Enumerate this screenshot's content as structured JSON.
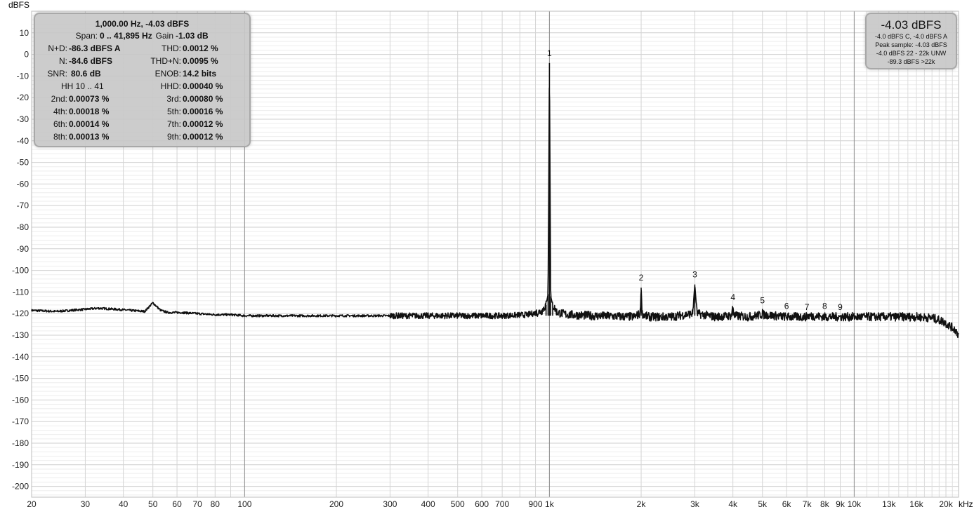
{
  "chart_data": {
    "type": "line",
    "ylabel": "dBFS",
    "xunit": "kHz",
    "xscale": "log",
    "xlim": [
      20,
      22000
    ],
    "ylim": [
      -205,
      20
    ],
    "y_ticks": [
      10,
      0,
      -10,
      -20,
      -30,
      -40,
      -50,
      -60,
      -70,
      -80,
      -90,
      -100,
      -110,
      -120,
      -130,
      -140,
      -150,
      -160,
      -170,
      -180,
      -190,
      -200
    ],
    "x_ticks": [
      {
        "v": 20,
        "label": "20"
      },
      {
        "v": 30,
        "label": "30"
      },
      {
        "v": 40,
        "label": "40"
      },
      {
        "v": 50,
        "label": "50"
      },
      {
        "v": 60,
        "label": "60"
      },
      {
        "v": 70,
        "label": "70"
      },
      {
        "v": 80,
        "label": "80"
      },
      {
        "v": 100,
        "label": "100"
      },
      {
        "v": 200,
        "label": "200"
      },
      {
        "v": 300,
        "label": "300"
      },
      {
        "v": 400,
        "label": "400"
      },
      {
        "v": 500,
        "label": "500"
      },
      {
        "v": 600,
        "label": "600"
      },
      {
        "v": 700,
        "label": "700"
      },
      {
        "v": 900,
        "label": "900"
      },
      {
        "v": 1000,
        "label": "1k"
      },
      {
        "v": 2000,
        "label": "2k"
      },
      {
        "v": 3000,
        "label": "3k"
      },
      {
        "v": 4000,
        "label": "4k"
      },
      {
        "v": 5000,
        "label": "5k"
      },
      {
        "v": 6000,
        "label": "6k"
      },
      {
        "v": 7000,
        "label": "7k"
      },
      {
        "v": 8000,
        "label": "8k"
      },
      {
        "v": 9000,
        "label": "9k"
      },
      {
        "v": 10000,
        "label": "10k"
      },
      {
        "v": 13000,
        "label": "13k"
      },
      {
        "v": 16000,
        "label": "16k"
      },
      {
        "v": 20000,
        "label": "20k"
      }
    ],
    "series": [
      {
        "x": [
          20,
          24,
          27,
          30,
          33,
          38,
          42,
          47,
          50,
          53,
          56,
          62,
          70,
          80,
          90,
          100,
          130,
          180,
          250,
          350,
          500,
          700,
          850,
          940,
          975,
          990,
          1000,
          1010,
          1025,
          1060,
          1150,
          1400,
          1900,
          1985,
          2000,
          2015,
          2100,
          2500,
          2950,
          3000,
          3050,
          3500,
          3950,
          4000,
          4050,
          4500,
          4980,
          5000,
          5020,
          6000,
          6980,
          7000,
          8000,
          9000,
          10000,
          13000,
          16000,
          18000,
          19500,
          20500,
          21500,
          22000
        ],
        "y": [
          -118.5,
          -119,
          -118.5,
          -118,
          -117.5,
          -118,
          -118.5,
          -119,
          -115,
          -118.5,
          -119.5,
          -119.5,
          -120,
          -120.5,
          -120.5,
          -121,
          -121,
          -121,
          -121,
          -121,
          -121,
          -121,
          -120.5,
          -119,
          -116,
          -111,
          -4,
          -112,
          -116,
          -119.5,
          -120.5,
          -121,
          -121.5,
          -120,
          -108,
          -120,
          -121.5,
          -121.5,
          -120,
          -106.5,
          -120,
          -121.5,
          -121,
          -117,
          -121,
          -121.5,
          -120.5,
          -118.5,
          -120.5,
          -121.5,
          -121.5,
          -121,
          -121.5,
          -121.5,
          -121.5,
          -121.5,
          -121.5,
          -122,
          -123.5,
          -125.5,
          -127.5,
          -130
        ]
      }
    ],
    "harmonic_markers": [
      {
        "label": "1",
        "x": 1000,
        "y": -4
      },
      {
        "label": "2",
        "x": 2000,
        "y": -108
      },
      {
        "label": "3",
        "x": 3000,
        "y": -106.5
      },
      {
        "label": "4",
        "x": 4000,
        "y": -117
      },
      {
        "label": "5",
        "x": 5000,
        "y": -118.5
      },
      {
        "label": "6",
        "x": 6000,
        "y": -121
      },
      {
        "label": "7",
        "x": 7000,
        "y": -121.5
      },
      {
        "label": "8",
        "x": 8000,
        "y": -121
      },
      {
        "label": "9",
        "x": 9000,
        "y": -121.5
      }
    ]
  },
  "stats": {
    "title": "1,000.00 Hz, -4.03 dBFS",
    "span_label": "Span:",
    "span_value": "0 .. 41,895 Hz",
    "gain_label": "Gain",
    "gain_value": "-1.03 dB",
    "nd_label": "N+D:",
    "nd_value": "-86.3 dBFS A",
    "thd_label": "THD:",
    "thd_value": "0.0012 %",
    "n_label": "N:",
    "n_value": "-84.6 dBFS",
    "thdn_label": "THD+N:",
    "thdn_value": "0.0095 %",
    "snr_label": "SNR:",
    "snr_value": "80.6 dB",
    "enob_label": "ENOB:",
    "enob_value": "14.2 bits",
    "hh_label": "HH 10 .. 41",
    "hhd_label": "HHD:",
    "hhd_value": "0.00040 %",
    "h2_label": "2nd:",
    "h2_value": "0.00073 %",
    "h3_label": "3rd:",
    "h3_value": "0.00080 %",
    "h4_label": "4th:",
    "h4_value": "0.00018 %",
    "h5_label": "5th:",
    "h5_value": "0.00016 %",
    "h6_label": "6th:",
    "h6_value": "0.00014 %",
    "h7_label": "7th:",
    "h7_value": "0.00012 %",
    "h8_label": "8th:",
    "h8_value": "0.00013 %",
    "h9_label": "9th:",
    "h9_value": "0.00012 %"
  },
  "level": {
    "main": "-4.03 dBFS",
    "line1": "-4.0 dBFS C, -4.0 dBFS A",
    "line2": "Peak sample: -4.03 dBFS",
    "line3": "-4.0 dBFS 22 - 22k UNW",
    "line4": "-89.3 dBFS >22k"
  }
}
